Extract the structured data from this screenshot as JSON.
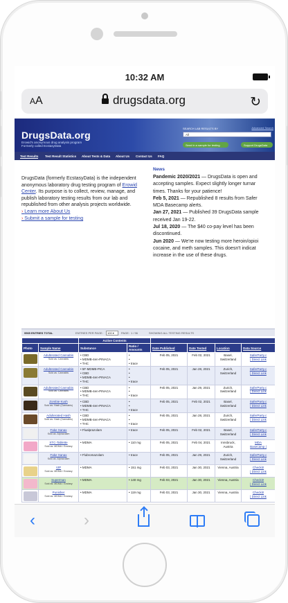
{
  "status": {
    "time": "10:32 AM"
  },
  "browser": {
    "text_size_label": "AA",
    "domain": "drugsdata.org",
    "reload_icon": "reload-icon",
    "lock_icon": "lock-icon"
  },
  "site": {
    "logo": "DrugsData.org",
    "tagline_1": "Erowid's anonymous drug analysis program",
    "tagline_2": "Formerly called EcstasyData",
    "search_label": "SEARCH LAB RESULTS BY",
    "search_value": "All",
    "advanced_search": "Advanced Search",
    "send_sample_btn": "Send in a sample for testing",
    "support_btn": "Support DrugsData",
    "nav": [
      "Test Results",
      "Test Result Statistics",
      "About Tests & Data",
      "About Us",
      "Contact Us",
      "FAQ"
    ],
    "intro_pre": "DrugsData (formerly EcstasyData) is the independent anonymous laboratory drug testing program of ",
    "intro_link": "Erowid Center",
    "intro_post": ". Its purpose is to collect, review, manage, and publish laboratory testing results from our lab and republished from other analysis projects worldwide.",
    "link_about": "Learn more About Us",
    "link_submit": "Submit a sample for testing",
    "news_title": "News",
    "news": [
      {
        "date": "Pandemic 2020/2021",
        "text": " — DrugsData is open and",
        "more": "accepting samples. Expect slightly longer turnar",
        "more2": "times. Thanks for your patience!"
      },
      {
        "date": "Feb 5, 2021",
        "text": " — Republished 8 results from Safer",
        "more": "MDA Basecamp alerts.",
        "more2": ""
      },
      {
        "date": "Jan 27, 2021",
        "text": " — Published 39 DrugsData sample",
        "more": "received Jan 19-22.",
        "more2": ""
      },
      {
        "date": "Jul 18, 2020",
        "text": " — The $40 co-pay level has been",
        "more": "discontinued.",
        "more2": ""
      },
      {
        "date": "Jun 2020",
        "text": " — We're now testing more heroin/opioi",
        "more": "cocaine, and meth samples. This doesn't indicat",
        "more2": "increase in the use of these drugs."
      }
    ],
    "table_bar": {
      "count": "9565 ENTRIES TOTAL",
      "per_page_label": "ENTRIES PER PAGE:",
      "per_page_value": "100",
      "page_label": "PAGE:",
      "page_value": "1 / 96",
      "show_all": "SHOWING ALL TESTING RESULTS"
    },
    "headers": {
      "active_contents": "Active Contents",
      "photo": "Photo",
      "sample_name": "Sample Name",
      "substance": "Substance",
      "ratio": "Ratio / Amounts",
      "date_published": "Date Published",
      "date_tested": "Date Tested",
      "location": "Location",
      "data_source": "Data Source"
    },
    "rows": [
      {
        "name": "Adulterated Cannabis",
        "sold": "Sold as: Cannabis",
        "subs": [
          "CBD",
          "MDMB-4en-PINACA",
          "THC"
        ],
        "amts": [
          "",
          "",
          "trace"
        ],
        "pub": "Feb 05, 2021",
        "tested": "Feb 02, 2021",
        "loc": "Basel, Switzerland",
        "src1": "SaferParty.c",
        "src2": "| Direct Link",
        "photo": "#7a6a2a"
      },
      {
        "name": "Adulterated Cannabis",
        "sold": "Sold as: Cannabis",
        "subs": [
          "5F-MDMB-PICA",
          "CBD",
          "MDMB-4en-PINACA",
          "THC"
        ],
        "amts": [
          "",
          "",
          "",
          "trace"
        ],
        "pub": "Feb 05, 2021",
        "tested": "Jan 28, 2021",
        "loc": "Zurich, Switzerland",
        "src1": "SaferParty.c",
        "src2": "| Direct Link",
        "photo": "#8a7a34"
      },
      {
        "name": "Adulterated Cannabis",
        "sold": "Sold as: Cannabis",
        "subs": [
          "CBD",
          "MDMB-4en-PINACA",
          "THC"
        ],
        "amts": [
          "",
          "",
          "trace"
        ],
        "pub": "Feb 05, 2021",
        "tested": "Jan 29, 2021",
        "loc": "Zurich, Switzerland",
        "src1": "SaferParty.c",
        "src2": "| Direct Link",
        "photo": "#5a4a22"
      },
      {
        "name": "Zombie Kush",
        "sold": "Sold as: Hash (Cannabis)",
        "subs": [
          "CBD",
          "MDMB-4en-PINACA",
          "THC"
        ],
        "amts": [
          "",
          "",
          "trace"
        ],
        "pub": "Feb 05, 2021",
        "tested": "Feb 02, 2021",
        "loc": "Basel, Switzerland",
        "src1": "SaferParty.c",
        "src2": "| Direct Link",
        "photo": "#3a2a1a"
      },
      {
        "name": "Adulterated Hash",
        "sold": "Sold as: Hash (Cannabis)",
        "subs": [
          "CBD",
          "MDMB-4en-PINACA",
          "THC"
        ],
        "amts": [
          "",
          "",
          "trace"
        ],
        "pub": "Feb 05, 2021",
        "tested": "Jan 28, 2021",
        "loc": "Zurich, Switzerland",
        "src1": "SaferParty.c",
        "src2": "| Direct Link",
        "photo": "#6a4a2a"
      },
      {
        "name": "Fake Xanax",
        "sold": "Sold as: Alprazolam",
        "subs": [
          "Flualprazolam"
        ],
        "amts": [
          "trace"
        ],
        "pub": "Feb 05, 2021",
        "tested": "Feb 02, 2021",
        "loc": "Basel, Switzerland",
        "src1": "SaferParty.c",
        "src2": "| Direct Link",
        "photo": "#f0f0f0"
      },
      {
        "name": "XTC-Tablette",
        "sold": "Sold as: MDMA / Ecstasy",
        "subs": [
          "MDMA"
        ],
        "amts": [
          "110 mg"
        ],
        "pub": "Feb 05, 2021",
        "tested": "Feb 04, 2021",
        "loc": "Innsbruck, Austria",
        "src1": "MDA",
        "src2": "Basecamp |",
        "photo": "#f2a8c8"
      },
      {
        "name": "Fake Xanax",
        "sold": "Sold as: Alprazolam",
        "subs": [
          "Flubromazolam"
        ],
        "amts": [
          "trace"
        ],
        "pub": "Feb 05, 2021",
        "tested": "Jan 29, 2021",
        "loc": "Zurich, Switzerland",
        "src1": "SaferParty.c",
        "src2": "| Direct Link",
        "photo": "#f4f4f4"
      },
      {
        "name": "VIP",
        "sold": "Sold as: MDMA / Ecstasy",
        "subs": [
          "MDMA"
        ],
        "amts": [
          "151 mg"
        ],
        "pub": "Feb 03, 2021",
        "tested": "Jan 30, 2021",
        "loc": "Vienna, Austria",
        "src1": "Checkit!",
        "src2": "| Direct Link",
        "photo": "#e8d28a"
      },
      {
        "name": "Superman",
        "sold": "Sold as: MDMA / Ecstasy",
        "subs": [
          "MDMA"
        ],
        "amts": [
          "140 mg"
        ],
        "pub": "Feb 03, 2021",
        "tested": "Jan 30, 2021",
        "loc": "Vienna, Austria",
        "src1": "Checkit!",
        "src2": "| Direct Link",
        "photo": "#f3b8cc",
        "highlight": true
      },
      {
        "name": "Punisher",
        "sold": "Sold as: MDMA / Ecstasy",
        "subs": [
          "MDMA"
        ],
        "amts": [
          "119 mg"
        ],
        "pub": "Feb 03, 2021",
        "tested": "Jan 30, 2021",
        "loc": "Vienna, Austria",
        "src1": "Checkit!",
        "src2": "| Direct Link",
        "photo": "#c8c8d8"
      }
    ]
  },
  "toolbar": {
    "back": "‹",
    "forward": "›"
  }
}
